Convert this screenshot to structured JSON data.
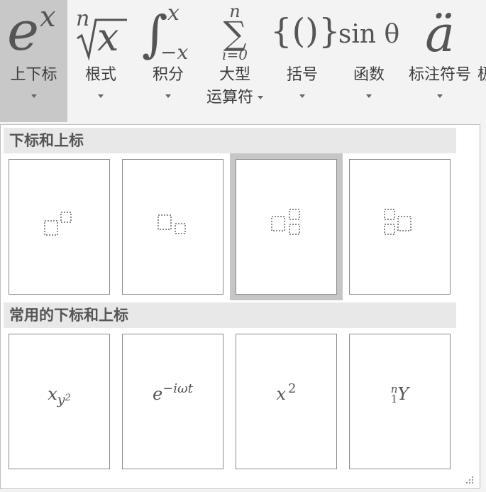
{
  "ribbon": {
    "buttons": [
      {
        "name": "script",
        "label": "上下标",
        "icon": "ex-icon"
      },
      {
        "name": "radical",
        "label": "根式",
        "icon": "nth-root-icon"
      },
      {
        "name": "integral",
        "label": "积分",
        "icon": "integral-icon"
      },
      {
        "name": "large-operator",
        "label_line1": "大型",
        "label_line2": "运算符",
        "icon": "sum-icon"
      },
      {
        "name": "bracket",
        "label": "括号",
        "icon": "braces-icon"
      },
      {
        "name": "function",
        "label": "函数",
        "icon": "sin-icon"
      },
      {
        "name": "accent",
        "label": "标注符号",
        "icon": "accent-icon"
      },
      {
        "name": "cut-off",
        "label": "极"
      }
    ],
    "glyphs": {
      "script_base": "e",
      "script_sup": "x",
      "root_index": "n",
      "root_radicand": "x",
      "int_upper": "x",
      "int_lower": "−x",
      "sum_upper": "n",
      "sum_lower": "i=0",
      "braces": "{()}",
      "func": "sin θ",
      "accent": "ä"
    }
  },
  "gallery": {
    "section1_title": "下标和上标",
    "section2_title": "常用的下标和上标",
    "templates": [
      {
        "name": "superscript-template",
        "icon": "superscript-icon"
      },
      {
        "name": "subscript-template",
        "icon": "subscript-icon"
      },
      {
        "name": "sub-superscript-template",
        "icon": "sub-sup-icon",
        "selected": true
      },
      {
        "name": "left-sub-superscript-template",
        "icon": "left-sub-sup-icon"
      }
    ],
    "common": [
      {
        "base": "x",
        "sub": "y",
        "subsup": "2"
      },
      {
        "base": "e",
        "sup": "−iωt"
      },
      {
        "base": "x",
        "sup": "2"
      },
      {
        "pre_sup": "n",
        "pre_sub": "1",
        "base": "Y"
      }
    ]
  },
  "colors": {
    "active_button": "#c8c8c8",
    "section_header": "#e8e8e8",
    "selected_ring": "#c6c6c6"
  }
}
